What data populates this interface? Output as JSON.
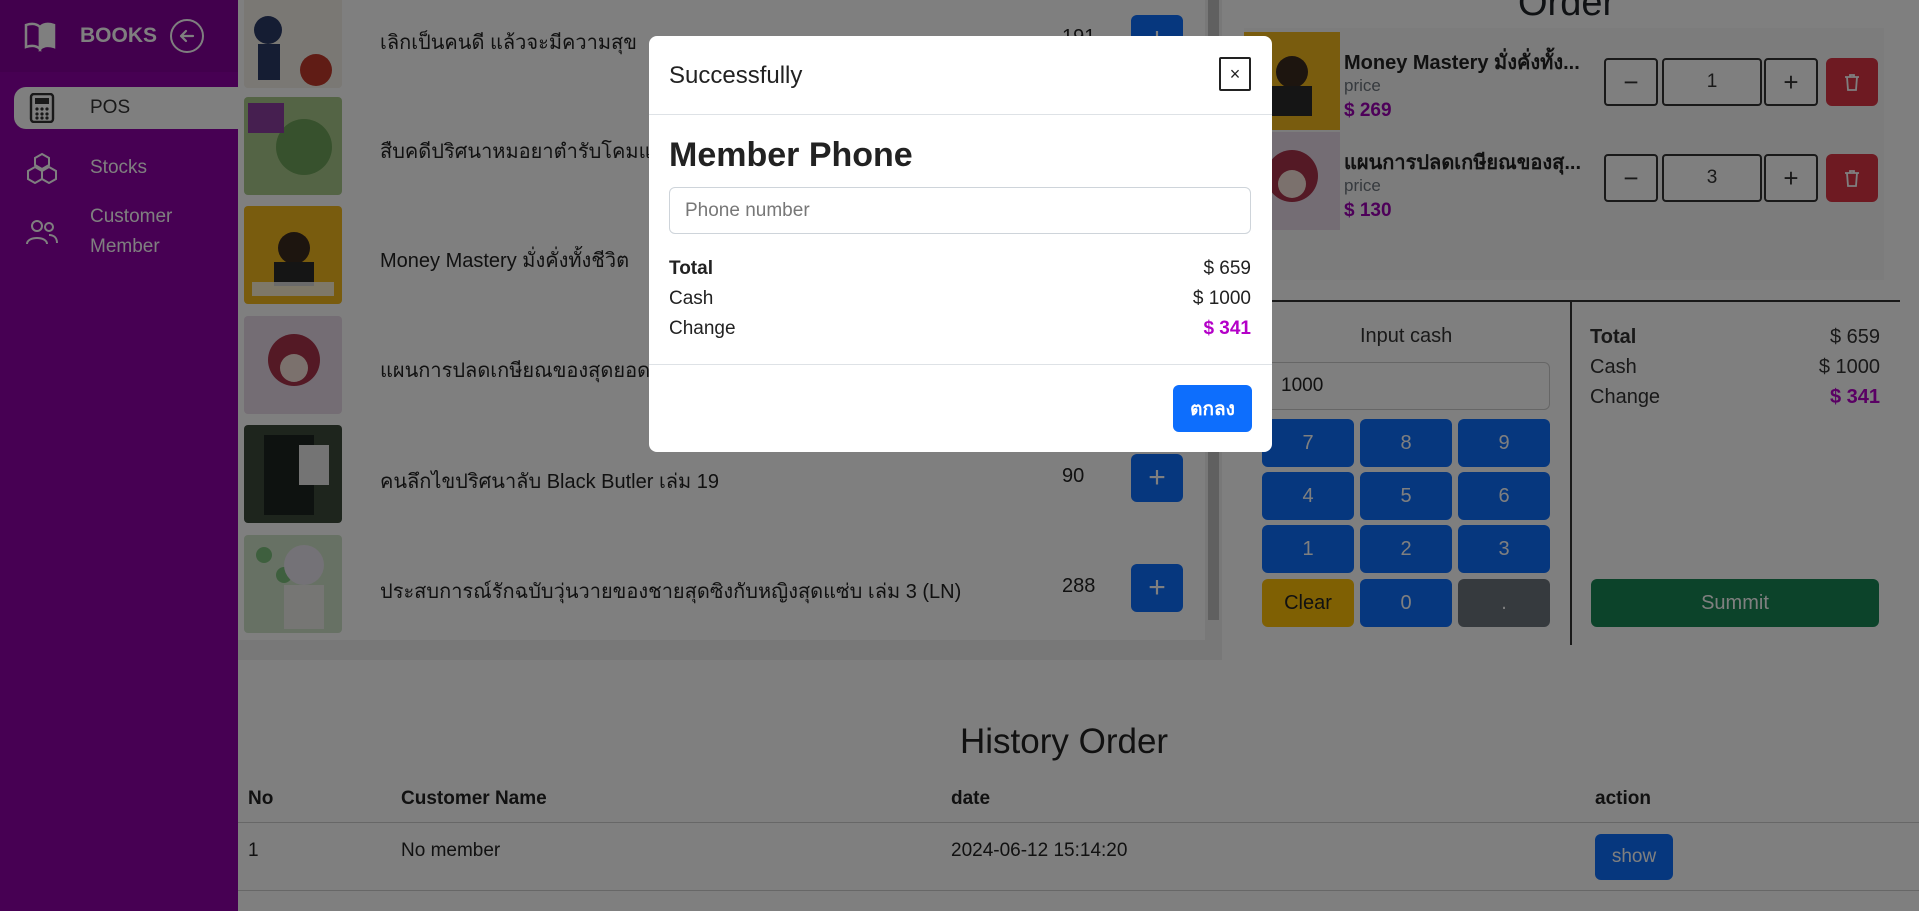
{
  "sidebar": {
    "brand": "BOOKS",
    "items": [
      {
        "label": "POS",
        "icon": "calculator-icon"
      },
      {
        "label": "Stocks",
        "icon": "cubes-icon"
      },
      {
        "label": "Customer Member",
        "icon": "people-icon"
      }
    ]
  },
  "products": [
    {
      "name": "เลิกเป็นคนดี แล้วจะมีความสุข",
      "stock": "191"
    },
    {
      "name": "สืบคดีปริศนาหมอยาตำรับโคมแดง",
      "stock": ""
    },
    {
      "name": "Money Mastery มั่งคั่งทั้งชีวิต",
      "stock": ""
    },
    {
      "name": "แผนการปลดเกษียณของสุดยอดจ",
      "stock": ""
    },
    {
      "name": "คนลึกไขปริศนาลับ Black Butler เล่ม 19",
      "stock": "90"
    },
    {
      "name": "ประสบการณ์รักฉบับวุ่นวายของชายสุดซิงกับหญิงสุดแซ่บ เล่ม 3 (LN)",
      "stock": "288"
    }
  ],
  "order": {
    "title": "Order",
    "items": [
      {
        "name": "Money Mastery มั่งคั่งทั้ง...",
        "price_label": "price",
        "price": "$ 269",
        "qty": "1"
      },
      {
        "name": "แผนการปลดเกษียณของสุ...",
        "price_label": "price",
        "price": "$ 130",
        "qty": "3"
      }
    ]
  },
  "cash": {
    "label": "Input cash",
    "value": "1000",
    "keys": [
      "7",
      "8",
      "9",
      "4",
      "5",
      "6",
      "1",
      "2",
      "3",
      "Clear",
      "0",
      "."
    ]
  },
  "summary": {
    "total_label": "Total",
    "total": "$ 659",
    "cash_label": "Cash",
    "cash": "$ 1000",
    "change_label": "Change",
    "change": "$ 341",
    "submit": "Summit"
  },
  "history": {
    "title": "History Order",
    "headers": [
      "No",
      "Customer Name",
      "date",
      "action"
    ],
    "rows": [
      {
        "no": "1",
        "customer": "No member",
        "date": "2024-06-12 15:14:20",
        "action": "show"
      }
    ]
  },
  "modal": {
    "title": "Successfully",
    "close": "×",
    "heading": "Member Phone",
    "phone_placeholder": "Phone number",
    "total_label": "Total",
    "total": "$ 659",
    "cash_label": "Cash",
    "cash": "$ 1000",
    "change_label": "Change",
    "change": "$ 341",
    "ok": "ตกลง"
  },
  "colors": {
    "sidebar": "#8e00a6",
    "primary": "#0d6efd",
    "danger": "#dc3545",
    "success": "#198754",
    "warning": "#ffc107",
    "accent_text": "#b400c8"
  }
}
